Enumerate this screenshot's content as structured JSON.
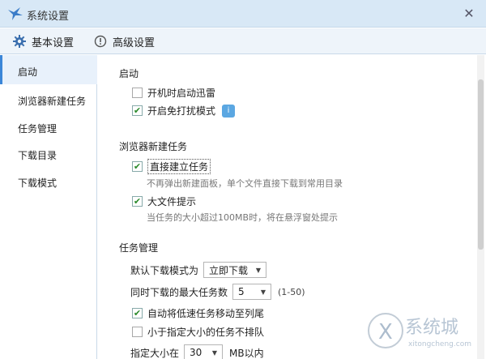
{
  "window": {
    "title": "系统设置",
    "close_glyph": "✕"
  },
  "tabs": [
    {
      "label": "基本设置",
      "icon": "gear-icon",
      "active": true
    },
    {
      "label": "高级设置",
      "icon": "alert-circle-icon",
      "active": false
    }
  ],
  "sidebar": {
    "items": [
      {
        "label": "启动",
        "selected": true
      },
      {
        "label": "浏览器新建任务"
      },
      {
        "label": "任务管理"
      },
      {
        "label": "下载目录"
      },
      {
        "label": "下载模式"
      }
    ]
  },
  "startup": {
    "heading": "启动",
    "opt_autostart": {
      "label": "开机时启动迅雷",
      "checked": false
    },
    "opt_nodisturb": {
      "label": "开启免打扰模式",
      "checked": true,
      "info_icon": "info-icon"
    }
  },
  "browser_task": {
    "heading": "浏览器新建任务",
    "opt_direct": {
      "label": "直接建立任务",
      "checked": true,
      "desc": "不再弹出新建面板，单个文件直接下载到常用目录"
    },
    "opt_bigfile": {
      "label": "大文件提示",
      "checked": true,
      "desc": "当任务的大小超过100MB时，将在悬浮窗处提示"
    }
  },
  "task_mgmt": {
    "heading": "任务管理",
    "default_mode": {
      "label": "默认下载模式为",
      "value": "立即下载"
    },
    "max_tasks": {
      "label": "同时下载的最大任务数",
      "value": "5",
      "range": "(1-50)"
    },
    "opt_move_slow": {
      "label": "自动将低速任务移动至列尾",
      "checked": true
    },
    "opt_small_noqueue": {
      "label": "小于指定大小的任务不排队",
      "checked": false
    },
    "size_limit": {
      "label": "指定大小在",
      "value": "30",
      "unit": "MB以内"
    }
  },
  "watermark": {
    "brand": "系统城",
    "site": "xitongcheng.com"
  },
  "colors": {
    "accent": "#3b86d8",
    "titlebar": "#d8e8f6",
    "check": "#2a8a2a"
  }
}
